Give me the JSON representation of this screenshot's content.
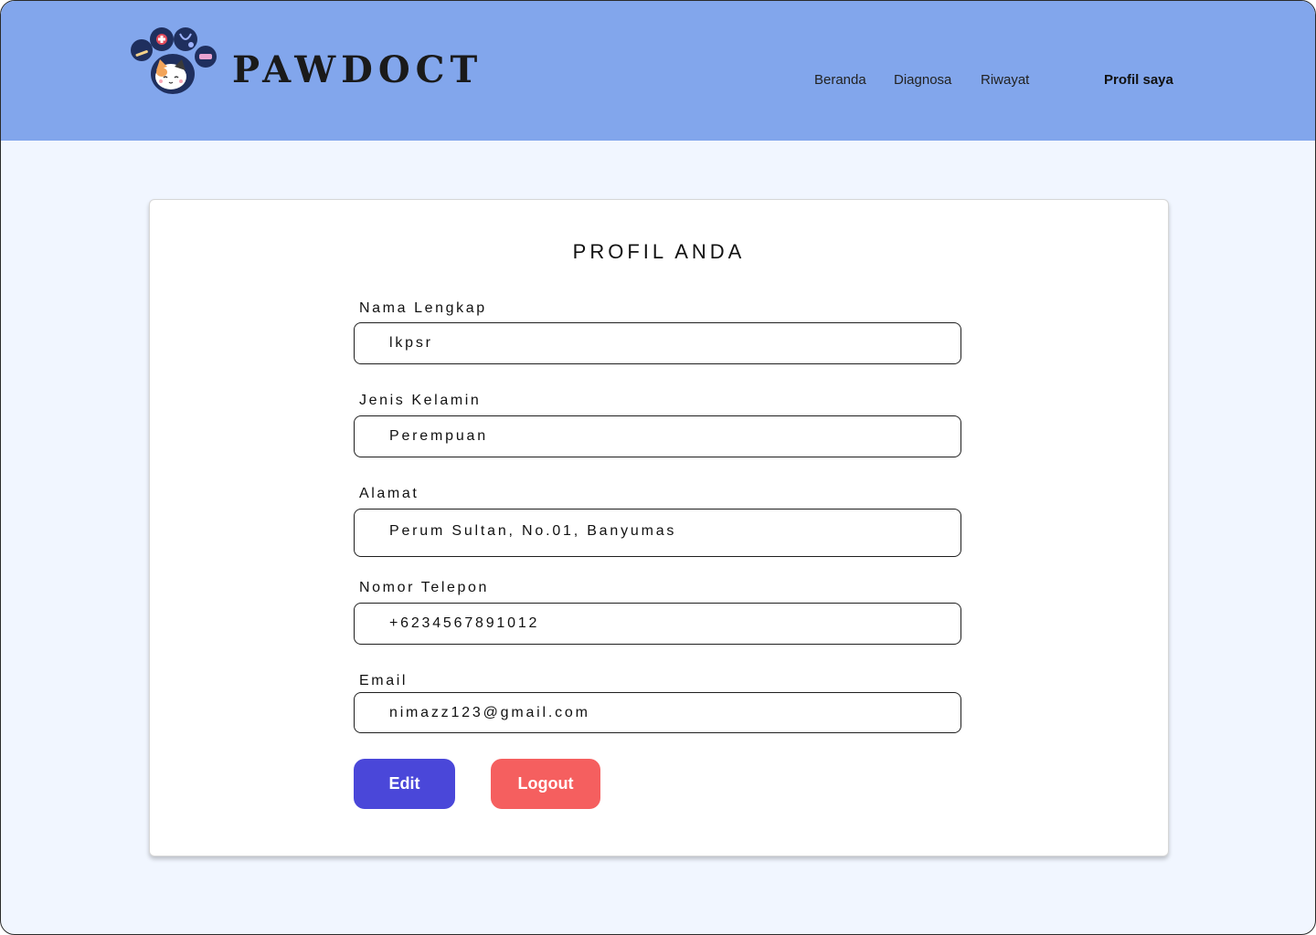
{
  "brand": {
    "name": "PAWDOCT",
    "logo_icon": "paw-cat-logo"
  },
  "nav": {
    "items": [
      {
        "label": "Beranda"
      },
      {
        "label": "Diagnosa"
      },
      {
        "label": "Riwayat"
      },
      {
        "label": "Profil saya"
      }
    ]
  },
  "profile": {
    "title": "PROFIL ANDA",
    "fields": [
      {
        "label": "Nama Lengkap",
        "value": "lkpsr"
      },
      {
        "label": "Jenis Kelamin",
        "value": "Perempuan"
      },
      {
        "label": "Alamat",
        "value": "Perum Sultan, No.01, Banyumas"
      },
      {
        "label": "Nomor Telepon",
        "value": "+6234567891012"
      },
      {
        "label": "Email",
        "value": "nimazz123@gmail.com"
      }
    ],
    "buttons": {
      "edit": "Edit",
      "logout": "Logout"
    }
  },
  "colors": {
    "navbar": "#82a6ec",
    "page_bg": "#f1f6ff",
    "edit_button": "#4a47d9",
    "logout_button": "#f55f5f"
  }
}
